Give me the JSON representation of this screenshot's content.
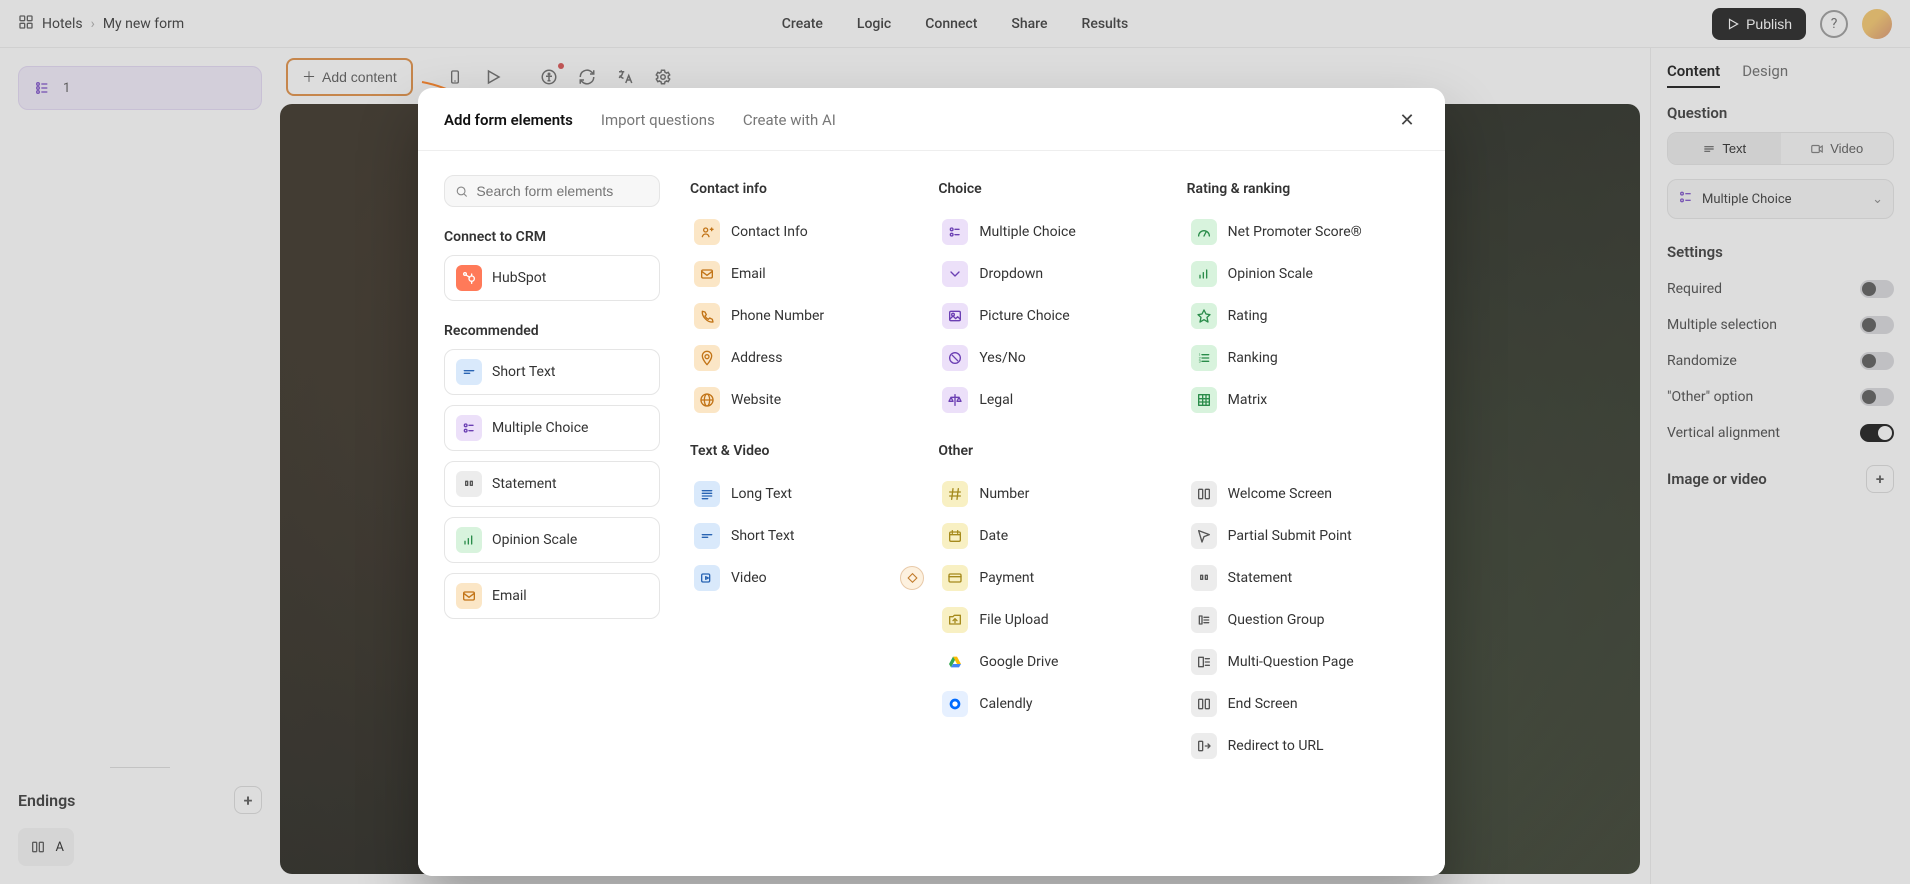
{
  "breadcrumb": {
    "workspace": "Hotels",
    "form": "My new form"
  },
  "topnav": {
    "create": "Create",
    "logic": "Logic",
    "connect": "Connect",
    "share": "Share",
    "results": "Results"
  },
  "topright": {
    "publish": "Publish"
  },
  "leftPanel": {
    "questionNumber": "1",
    "endingsTitle": "Endings",
    "endingLetter": "A"
  },
  "toolbar": {
    "addContent": "Add content"
  },
  "rightPanel": {
    "tabs": {
      "content": "Content",
      "design": "Design"
    },
    "questionTitle": "Question",
    "seg": {
      "text": "Text",
      "video": "Video"
    },
    "typeSelect": "Multiple Choice",
    "settingsTitle": "Settings",
    "toggles": {
      "required": "Required",
      "multiple": "Multiple selection",
      "randomize": "Randomize",
      "other": "\"Other\" option",
      "vertical": "Vertical alignment"
    },
    "imageTitle": "Image or video"
  },
  "modal": {
    "tabs": {
      "add": "Add form elements",
      "import": "Import questions",
      "ai": "Create with AI"
    },
    "searchPlaceholder": "Search form elements",
    "connectTitle": "Connect to CRM",
    "crm": {
      "hubspot": "HubSpot"
    },
    "recommendedTitle": "Recommended",
    "recommended": {
      "shortText": "Short Text",
      "multipleChoice": "Multiple Choice",
      "statement": "Statement",
      "opinionScale": "Opinion Scale",
      "email": "Email"
    },
    "groups": {
      "contact": "Contact info",
      "choice": "Choice",
      "rating": "Rating & ranking",
      "textvideo": "Text & Video",
      "other": "Other"
    },
    "items": {
      "contactInfo": "Contact Info",
      "email": "Email",
      "phone": "Phone Number",
      "address": "Address",
      "website": "Website",
      "multipleChoice": "Multiple Choice",
      "dropdown": "Dropdown",
      "pictureChoice": "Picture Choice",
      "yesNo": "Yes/No",
      "legal": "Legal",
      "nps": "Net Promoter Score®",
      "opinionScale": "Opinion Scale",
      "rating": "Rating",
      "ranking": "Ranking",
      "matrix": "Matrix",
      "longText": "Long Text",
      "shortText": "Short Text",
      "video": "Video",
      "number": "Number",
      "date": "Date",
      "payment": "Payment",
      "fileUpload": "File Upload",
      "googleDrive": "Google Drive",
      "calendly": "Calendly",
      "welcome": "Welcome Screen",
      "partialSubmit": "Partial Submit Point",
      "statement": "Statement",
      "questionGroup": "Question Group",
      "multiQuestion": "Multi-Question Page",
      "endScreen": "End Screen",
      "redirect": "Redirect to URL"
    }
  }
}
